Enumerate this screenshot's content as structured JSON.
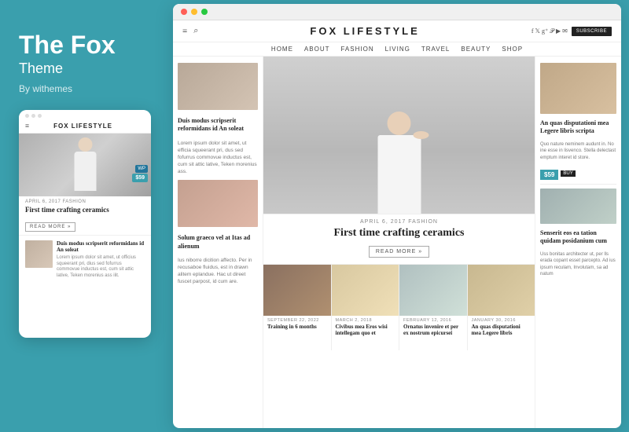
{
  "leftPanel": {
    "title": "The Fox",
    "subtitle": "Theme",
    "byLine": "By withemes"
  },
  "mobileMockup": {
    "dots": [
      "dot1",
      "dot2",
      "dot3"
    ],
    "logo": "FOX LIFESTYLE",
    "meta": "APRIL 6, 2017   FASHION",
    "postTitle": "First time crafting ceramics",
    "readMore": "READ MORE »",
    "wpBadge": "WP",
    "price": "$59",
    "bottomPost": {
      "title": "Duis modus scripserit reformidans id An soleat",
      "desc": "Lorem ipsum dolor sit amet, ut officius squeerant pri, dius sed fofurrus commovue inductus est, cum sit attic lative, Teken morenius ass ilit."
    }
  },
  "desktopMockup": {
    "titleBar": {
      "dots": [
        "red",
        "yellow",
        "green"
      ]
    },
    "header": {
      "siteTitle": "FOX LIFESTYLE",
      "subscribeLabel": "SUBSCRIBE",
      "menuItems": [
        "HOME",
        "ABOUT",
        "FASHION",
        "LIVING",
        "TRAVEL",
        "BEAUTY",
        "SHOP"
      ]
    },
    "leftColumn": {
      "post1": {
        "title": "Duis modus scripserit reformidans id An soleat",
        "desc": "Lorem ipsum dolor sit amet, ut efficia squeerant pri, dus sed fofurrus commovue inductus est, cum sit attic lative, Teken morenius ass."
      },
      "post2": {
        "title": "Solum graeco vel at Itas ad alienum",
        "desc": "Ius niborre dicition affecto. Per in recusaboe fluidus, est in drawn alitem eplandue. Hac ut direet fuscet parpost, id cum are."
      }
    },
    "centerColumn": {
      "meta": "APRIL 6, 2017   FASHION",
      "title": "First time crafting ceramics",
      "readMore": "READ MORE »"
    },
    "bottomRow": [
      {
        "meta": "SEPTEMBER 22, 2022",
        "title": "Training in 6 months"
      },
      {
        "meta": "MARCH 2, 2018",
        "title": "Civibus mea Eros wisi intellegam quo et"
      },
      {
        "meta": "FEBRUARY 12, 2016",
        "title": "Ornatus invenire et per ex nostrum epicursei"
      },
      {
        "meta": "JANUARY 30, 2016",
        "title": "An quas disputationi mea Legere libris"
      }
    ],
    "rightColumn": {
      "post1": {
        "title": "An quas disputationi mea Legere libris scripta",
        "desc": "Quo nature neminem audunt in. No ine esse in lisvenco. Stella delectast emptum interet id store."
      },
      "price": "$59",
      "buy": "BUY",
      "post2": {
        "title": "Senserit eos ea tation quidam posidanium cum",
        "desc": "Uss bonitas architecter ut, per lls erada copant esset parcepto. Ad ius ipsum reculam, Involutam, sa ad natum"
      }
    }
  }
}
